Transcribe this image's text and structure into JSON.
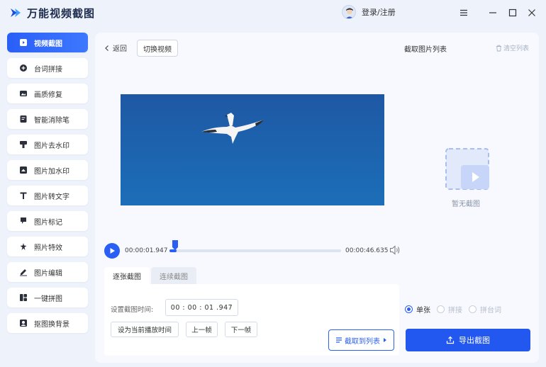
{
  "app": {
    "name": "万能视频截图",
    "login": "登录/注册"
  },
  "sidebar": {
    "items": [
      {
        "label": "视频截图",
        "icon": "video-screenshot-icon",
        "active": true
      },
      {
        "label": "台词拼接",
        "icon": "subtitle-stitch-icon"
      },
      {
        "label": "画质修复",
        "icon": "image-repair-icon"
      },
      {
        "label": "智能消除笔",
        "icon": "smart-eraser-icon"
      },
      {
        "label": "图片去水印",
        "icon": "remove-watermark-icon"
      },
      {
        "label": "图片加水印",
        "icon": "add-watermark-icon"
      },
      {
        "label": "图片转文字",
        "icon": "text-t-icon"
      },
      {
        "label": "图片标记",
        "icon": "flag-icon"
      },
      {
        "label": "照片特效",
        "icon": "effects-icon"
      },
      {
        "label": "图片编辑",
        "icon": "edit-icon"
      },
      {
        "label": "一键拼图",
        "icon": "collage-icon"
      },
      {
        "label": "抠图换背景",
        "icon": "cutout-icon"
      }
    ]
  },
  "toolbar": {
    "back": "返回",
    "switch_video": "切换视频"
  },
  "list": {
    "title": "截取图片列表",
    "clear": "清空列表",
    "empty": "暂无截图"
  },
  "player": {
    "current_time": "00:00:01.947",
    "total_time": "00:00:46.635",
    "progress": 0.042
  },
  "tabs": {
    "single": "逐张截图",
    "continuous": "连续截图"
  },
  "panel": {
    "time_label": "设置截图时间:",
    "time_value": "00 : 00 : 01 .947",
    "set_current": "设为当前播放时间",
    "prev_frame": "上一帧",
    "next_frame": "下一帧",
    "capture": "截取到列表"
  },
  "export": {
    "options": [
      {
        "label": "单张",
        "selected": true
      },
      {
        "label": "拼接",
        "selected": false
      },
      {
        "label": "拼台词",
        "selected": false
      }
    ],
    "button": "导出截图"
  },
  "colors": {
    "accent": "#2a5ff6",
    "video_bg": "#1c62ad"
  }
}
